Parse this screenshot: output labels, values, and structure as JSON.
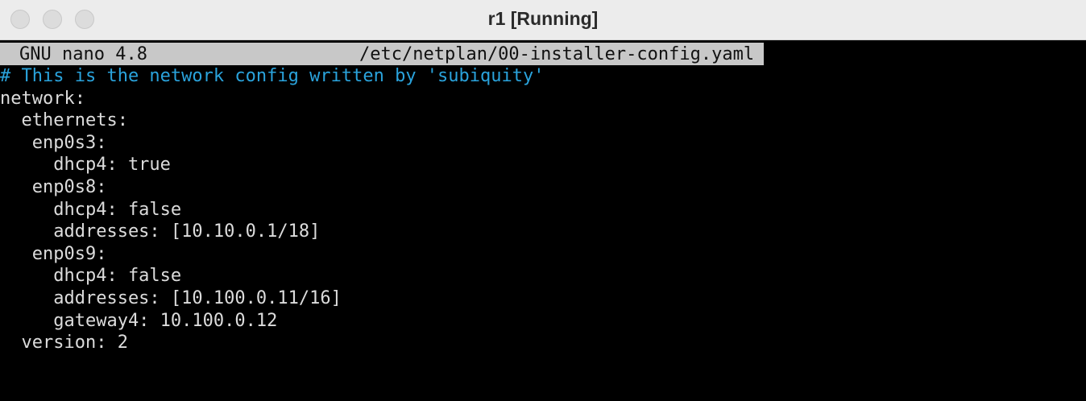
{
  "window": {
    "title": "r1 [Running]"
  },
  "nano": {
    "version": "GNU nano 4.8",
    "filename": "/etc/netplan/00-installer-config.yaml"
  },
  "file": {
    "lines": [
      {
        "text": "# This is the network config written by 'subiquity'",
        "type": "comment"
      },
      {
        "text": "network:",
        "type": "code"
      },
      {
        "text": "  ethernets:",
        "type": "code"
      },
      {
        "text": "   enp0s3:",
        "type": "code"
      },
      {
        "text": "     dhcp4: true",
        "type": "code"
      },
      {
        "text": "   enp0s8:",
        "type": "code"
      },
      {
        "text": "     dhcp4: false",
        "type": "code"
      },
      {
        "text": "     addresses: [10.10.0.1/18]",
        "type": "code"
      },
      {
        "text": "   enp0s9:",
        "type": "code"
      },
      {
        "text": "     dhcp4: false",
        "type": "code"
      },
      {
        "text": "     addresses: [10.100.0.11/16]",
        "type": "code"
      },
      {
        "text": "     gateway4: 10.100.0.12",
        "type": "code"
      },
      {
        "text": "  version: 2",
        "type": "code"
      }
    ]
  },
  "colors": {
    "comment": "#2aa3dc",
    "text": "#dcdcdc",
    "header_bg": "#c8c8c8",
    "terminal_bg": "#000000"
  }
}
